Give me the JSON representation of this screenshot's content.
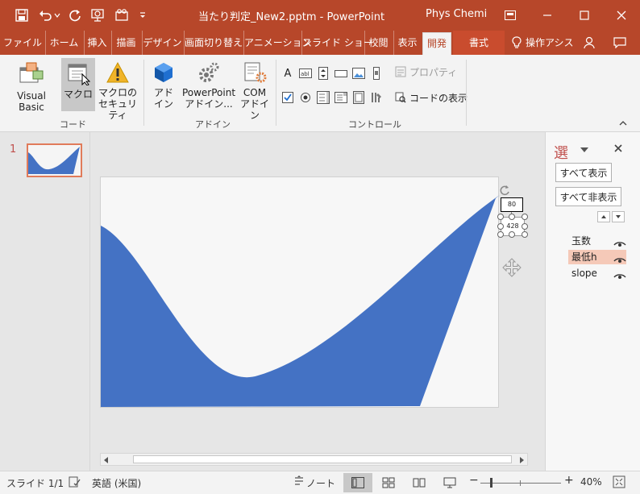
{
  "window": {
    "title": "当たり判定_New2.pptm  -  PowerPoint",
    "user": "Phys Chemi"
  },
  "tabs": [
    {
      "label": "ファイル"
    },
    {
      "label": "ホーム"
    },
    {
      "label": "挿入"
    },
    {
      "label": "描画"
    },
    {
      "label": "デザイン"
    },
    {
      "label": "画面切り替え"
    },
    {
      "label": "アニメーション"
    },
    {
      "label": "スライド ショー"
    },
    {
      "label": "校閲"
    },
    {
      "label": "表示"
    },
    {
      "label": "開発"
    },
    {
      "label": "書式"
    },
    {
      "label": "操作アシス"
    }
  ],
  "ribbon": {
    "code_group": {
      "visual_basic": "Visual Basic",
      "macro": "マクロ",
      "macro_security_1": "マクロの",
      "macro_security_2": "セキュリティ",
      "label": "コード"
    },
    "addin_group": {
      "addin_1": "アド",
      "addin_2": "イン",
      "pp_addin_1": "PowerPoint",
      "pp_addin_2": "アドイン...",
      "com_addin_1": "COM",
      "com_addin_2": "アドイン",
      "label": "アドイン"
    },
    "control_group": {
      "properties": "プロパティ",
      "view_code": "コードの表示",
      "label": "コントロール"
    }
  },
  "thumbnails": [
    {
      "number": "1"
    }
  ],
  "shape_labels": {
    "top": "80",
    "bottom": "428"
  },
  "selection_pane": {
    "title": "選",
    "show_all": "すべて表示",
    "hide_all": "すべて非表示",
    "items": [
      {
        "name": "玉数"
      },
      {
        "name": "最低h"
      },
      {
        "name": "slope"
      }
    ]
  },
  "statusbar": {
    "slide": "スライド 1/1",
    "language": "英語 (米国)",
    "notes": "ノート",
    "zoom": "40%"
  },
  "colors": {
    "accent": "#b7472a",
    "shape_fill": "#4472c4",
    "selected_item": "#f5c9b8"
  }
}
